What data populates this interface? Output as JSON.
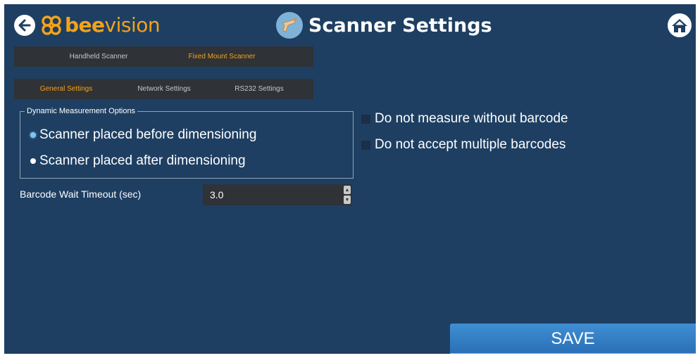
{
  "header": {
    "logo_bee": "bee",
    "logo_vision": "vision",
    "title": "Scanner Settings",
    "back_icon": "arrow-left-icon",
    "home_icon": "home-icon",
    "scanner_icon": "barcode-scanner-icon"
  },
  "scanner_tabs": [
    {
      "label": "Handheld Scanner",
      "active": false
    },
    {
      "label": "Fixed Mount Scanner",
      "active": true
    }
  ],
  "settings_tabs": [
    {
      "label": "General Settings",
      "active": true
    },
    {
      "label": "Network Settings",
      "active": false
    },
    {
      "label": "RS232 Settings",
      "active": false
    }
  ],
  "dynamic_options": {
    "legend": "Dynamic Measurement Options",
    "options": [
      {
        "label": "Scanner placed before dimensioning",
        "checked": true
      },
      {
        "label": "Scanner placed after dimensioning",
        "checked": false
      }
    ]
  },
  "checkboxes": [
    {
      "label": "Do not measure without barcode",
      "checked": false
    },
    {
      "label": "Do not accept multiple barcodes",
      "checked": false
    }
  ],
  "barcode_timeout": {
    "label": "Barcode Wait Timeout (sec)",
    "value": "3.0"
  },
  "save_label": "SAVE",
  "colors": {
    "background": "#1e3f62",
    "accent": "#f4a21a",
    "tab_bar": "#2f3236",
    "save_button": "#3a86cc"
  }
}
